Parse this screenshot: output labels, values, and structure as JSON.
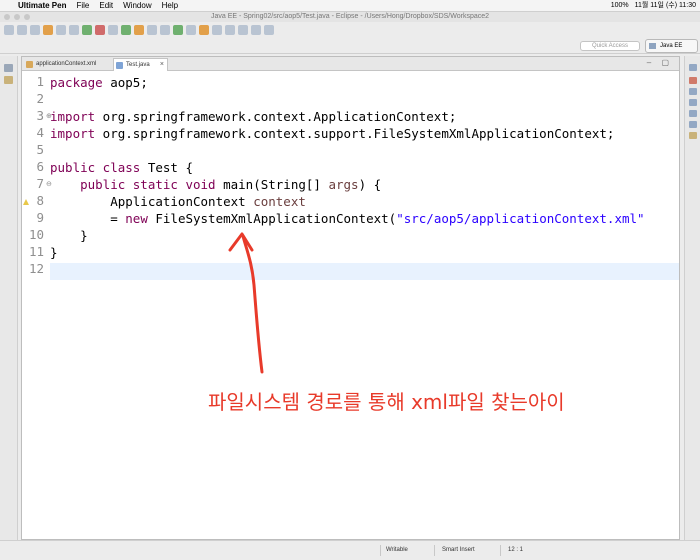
{
  "menubar": {
    "app_name": "Ultimate Pen",
    "items": [
      "File",
      "Edit",
      "Window",
      "Help"
    ],
    "battery": "100%",
    "datetime": "11월 11일 (수) 11:30"
  },
  "window": {
    "title": "Java EE - Spring02/src/aop5/Test.java - Eclipse - /Users/Hong/Dropbox/SDS/Workspace2"
  },
  "toolbar": {
    "quick_access_placeholder": "Quick Access",
    "perspective_label": "Java EE"
  },
  "editor": {
    "tabs": [
      {
        "label": "applicationContext.xml",
        "active": false
      },
      {
        "label": "Test.java",
        "active": true
      }
    ],
    "line_numbers": [
      "1",
      "2",
      "3",
      "4",
      "5",
      "6",
      "7",
      "8",
      "9",
      "10",
      "11",
      "12"
    ],
    "code": {
      "l1_kw": "package",
      "l1_rest": " aop5;",
      "l3_kw": "import",
      "l3_rest": " org.springframework.context.ApplicationContext;",
      "l4_kw": "import",
      "l4_rest": " org.springframework.context.support.FileSystemXmlApplicationContext;",
      "l6_kw": "public class",
      "l6_rest": " Test {",
      "l7_kw": "    public static void",
      "l7_rest": " main(String[] ",
      "l7_var": "args",
      "l7_end": ") {",
      "l8_type": "        ApplicationContext ",
      "l8_var": "context",
      "l9_pre": "        = ",
      "l9_kw": "new",
      "l9_mid": " FileSystemXmlApplicationContext(",
      "l9_str": "\"src/aop5/applicationContext.xml\"",
      "l10": "    }",
      "l11": "}"
    }
  },
  "annotation": {
    "text": "파일시스템 경로를 통해 xml파일 찾는아이",
    "color": "#e83a2a"
  },
  "status": {
    "writable": "Writable",
    "insert_mode": "Smart Insert",
    "position": "12 : 1"
  }
}
